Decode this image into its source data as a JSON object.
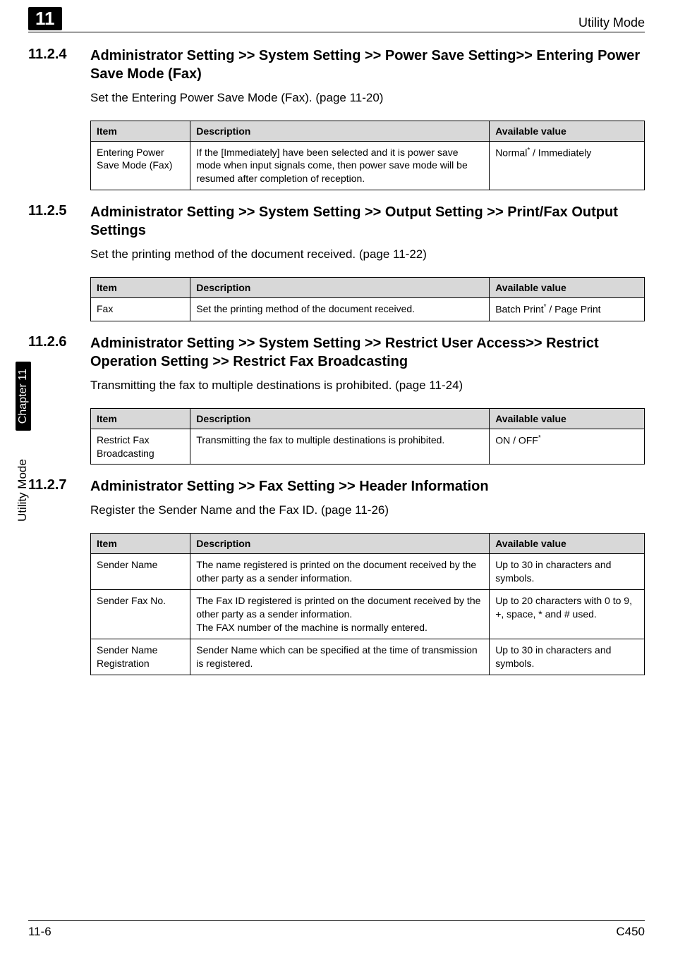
{
  "header": {
    "badge": "11",
    "running_head": "Utility Mode"
  },
  "sections": [
    {
      "num": "11.2.4",
      "title": "Administrator Setting >> System Setting >> Power Save Setting>> Entering Power Save Mode (Fax)",
      "body": "Set the Entering Power Save Mode (Fax). (page 11-20)",
      "table": {
        "headers": [
          "Item",
          "Description",
          "Available value"
        ],
        "rows": [
          [
            "Entering Power Save Mode (Fax)",
            "If the [Immediately] have been selected and it is power save mode when input signals come, then power save mode will be resumed after completion of reception.",
            "Normal* / Immediately"
          ]
        ]
      }
    },
    {
      "num": "11.2.5",
      "title": "Administrator Setting >> System Setting >> Output Setting >> Print/Fax Output Settings",
      "body": "Set the printing method of the document received. (page 11-22)",
      "table": {
        "headers": [
          "Item",
          "Description",
          "Available value"
        ],
        "rows": [
          [
            "Fax",
            "Set the printing method of the document received.",
            "Batch Print* / Page Print"
          ]
        ]
      }
    },
    {
      "num": "11.2.6",
      "title": "Administrator Setting >> System Setting >> Restrict User Access>> Restrict Operation Setting >> Restrict Fax Broadcasting",
      "body": "Transmitting the fax to multiple destinations is prohibited. (page 11-24)",
      "table": {
        "headers": [
          "Item",
          "Description",
          "Available value"
        ],
        "rows": [
          [
            "Restrict Fax Broadcasting",
            "Transmitting the fax to multiple destinations is prohibited.",
            "ON / OFF*"
          ]
        ]
      }
    },
    {
      "num": "11.2.7",
      "title": "Administrator Setting >> Fax Setting >> Header Information",
      "body": "Register the Sender Name and the Fax ID. (page 11-26)",
      "table": {
        "headers": [
          "Item",
          "Description",
          "Available value"
        ],
        "rows": [
          [
            "Sender Name",
            "The name registered is printed on the document received by the other party as a sender information.",
            "Up to 30 in characters and symbols."
          ],
          [
            "Sender Fax No.",
            "The Fax ID registered is printed on the document received by the other party as a sender information.\nThe FAX number of the machine is normally entered.",
            "Up to 20 characters with 0 to 9, +, space, * and # used."
          ],
          [
            "Sender Name Registration",
            "Sender Name which can be specified at the time of transmission is registered.",
            "Up to 30 in characters and symbols."
          ]
        ]
      }
    }
  ],
  "side": {
    "chapter": "Chapter 11",
    "section": "Utility Mode"
  },
  "footer": {
    "page": "11-6",
    "model": "C450"
  }
}
